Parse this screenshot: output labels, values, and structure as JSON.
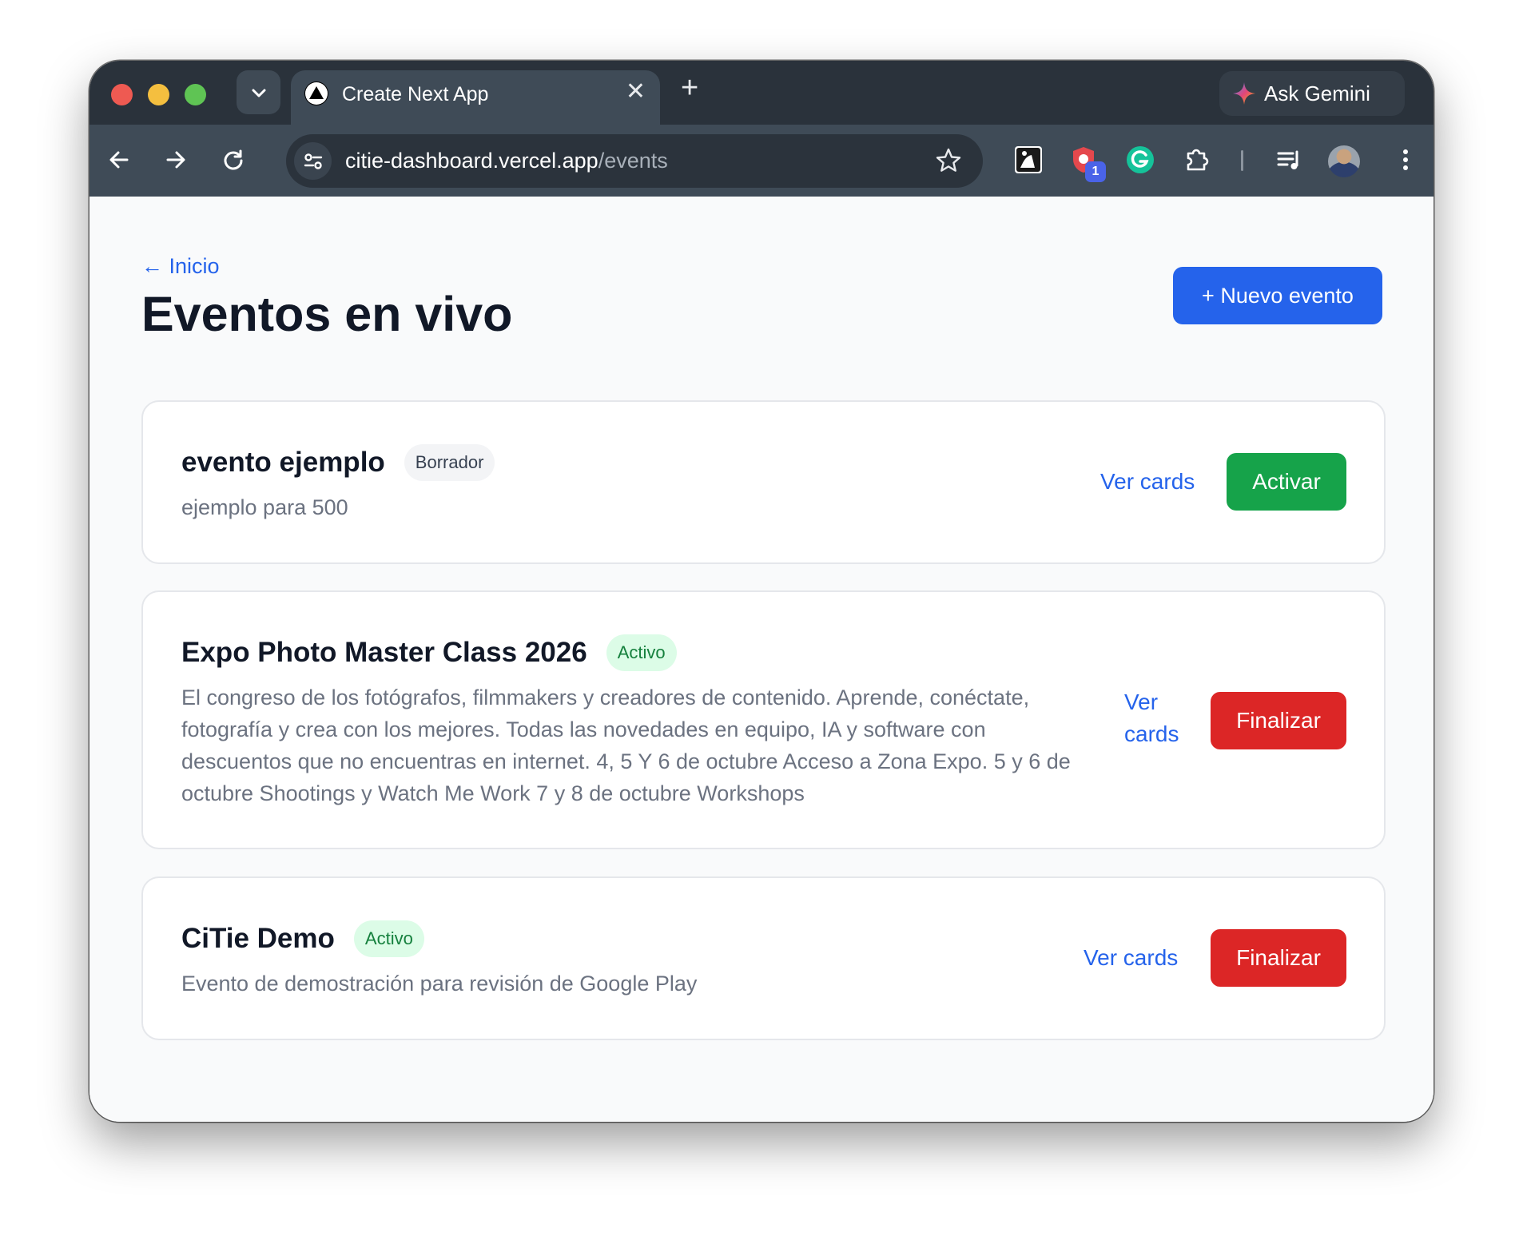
{
  "browser": {
    "tab_title": "Create Next App",
    "new_tab_symbol": "+",
    "close_symbol": "✕",
    "gemini_label": "Ask Gemini",
    "url_host": "citie-dashboard.vercel.app",
    "url_path": "/events",
    "extension_badge": "1",
    "icons": [
      "tab-search-icon",
      "nextjs-favicon-icon",
      "gemini-sparkle-icon",
      "back-arrow-icon",
      "forward-arrow-icon",
      "reload-icon",
      "site-settings-icon",
      "bookmark-star-icon",
      "kindle-extension-icon",
      "shield-extension-icon",
      "grammarly-extension-icon",
      "extensions-puzzle-icon",
      "media-controls-icon",
      "profile-avatar",
      "more-menu-icon"
    ]
  },
  "page": {
    "back_link": "← Inicio",
    "title": "Eventos en vivo",
    "new_event_button": "+ Nuevo evento"
  },
  "colors": {
    "primary": "#2563eb",
    "activate": "#16a34a",
    "finalize": "#dc2626",
    "active_chip_bg": "#dcfce7",
    "draft_chip_bg": "#f3f4f6"
  },
  "events": [
    {
      "name": "evento ejemplo",
      "status": "Borrador",
      "description": "ejemplo para 500",
      "view_label": "Ver cards",
      "action_label": "Activar"
    },
    {
      "name": "Expo Photo Master Class 2026",
      "status": "Activo",
      "description": "El congreso de los fotógrafos, filmmakers y creadores de contenido. Aprende, conéctate, fotografía y crea con los mejores. Todas las novedades en equipo, IA y software con descuentos que no encuentras en internet. 4, 5 Y 6 de octubre Acceso a Zona Expo. 5 y 6 de octubre Shootings y Watch Me Work 7 y 8 de octubre Workshops",
      "view_label": "Ver cards",
      "action_label": "Finalizar"
    },
    {
      "name": "CiTie Demo",
      "status": "Activo",
      "description": "Evento de demostración para revisión de Google Play",
      "view_label": "Ver cards",
      "action_label": "Finalizar"
    }
  ]
}
